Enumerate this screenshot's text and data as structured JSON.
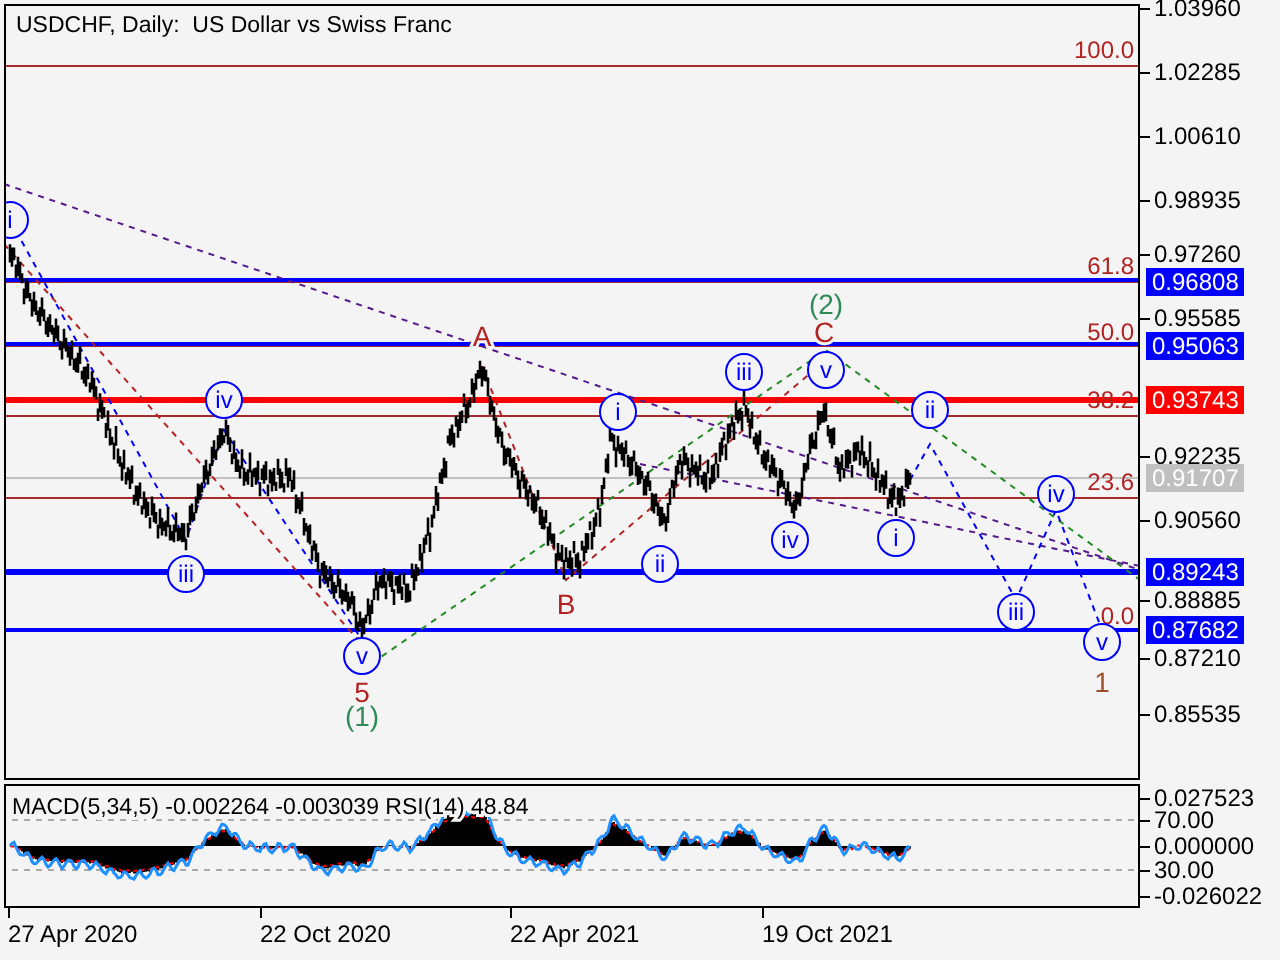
{
  "title": "USDCHF, Daily:  US Dollar vs Swiss Franc",
  "price_axis": {
    "ticks": [
      "1.03960",
      "1.02285",
      "1.00610",
      "0.98935",
      "0.97260",
      "0.95585",
      "0.92235",
      "0.90560",
      "0.88885",
      "0.87210",
      "0.85535"
    ]
  },
  "price_tags": [
    {
      "text": "0.96808",
      "color": "#0000ff"
    },
    {
      "text": "0.95063",
      "color": "#0000ff"
    },
    {
      "text": "0.93743",
      "color": "#ff0000"
    },
    {
      "text": "0.91707",
      "color": "#c0c0c0"
    },
    {
      "text": "0.89243",
      "color": "#0000ff"
    },
    {
      "text": "0.87682",
      "color": "#0000ff"
    }
  ],
  "fib_levels": [
    {
      "label": "100.0"
    },
    {
      "label": "61.8"
    },
    {
      "label": "50.0"
    },
    {
      "label": "38.2"
    },
    {
      "label": "23.6"
    },
    {
      "label": "0.0"
    }
  ],
  "wave_labels": [
    {
      "text": "i",
      "kind": "circled"
    },
    {
      "text": "iv",
      "kind": "circled"
    },
    {
      "text": "iii",
      "kind": "circled"
    },
    {
      "text": "v",
      "kind": "circled"
    },
    {
      "text": "5",
      "kind": "plain",
      "color": "#b22222"
    },
    {
      "text": "(1)",
      "kind": "plain",
      "color": "#2e8b57"
    },
    {
      "text": "A",
      "kind": "plain",
      "color": "#b22222"
    },
    {
      "text": "B",
      "kind": "plain",
      "color": "#b22222"
    },
    {
      "text": "i",
      "kind": "circled"
    },
    {
      "text": "ii",
      "kind": "circled"
    },
    {
      "text": "iii",
      "kind": "circled"
    },
    {
      "text": "(2)",
      "kind": "plain",
      "color": "#2e8b57"
    },
    {
      "text": "C",
      "kind": "plain",
      "color": "#b22222"
    },
    {
      "text": "v",
      "kind": "circled"
    },
    {
      "text": "iv",
      "kind": "circled"
    },
    {
      "text": "i",
      "kind": "circled"
    },
    {
      "text": "ii",
      "kind": "circled"
    },
    {
      "text": "iv",
      "kind": "circled"
    },
    {
      "text": "iii",
      "kind": "circled"
    },
    {
      "text": "v",
      "kind": "circled"
    },
    {
      "text": "1",
      "kind": "plain",
      "color": "#a0522d"
    }
  ],
  "indicator": {
    "legend": "MACD(5,34,5) -0.002264 -0.003039 RSI(14) 48.84",
    "ticks": [
      "0.027523",
      "70.00",
      "0.000000",
      "30.00",
      "-0.026022"
    ]
  },
  "date_axis": {
    "labels": [
      "27 Apr 2020",
      "22 Oct 2020",
      "22 Apr 2021",
      "19 Oct 2021"
    ]
  }
}
